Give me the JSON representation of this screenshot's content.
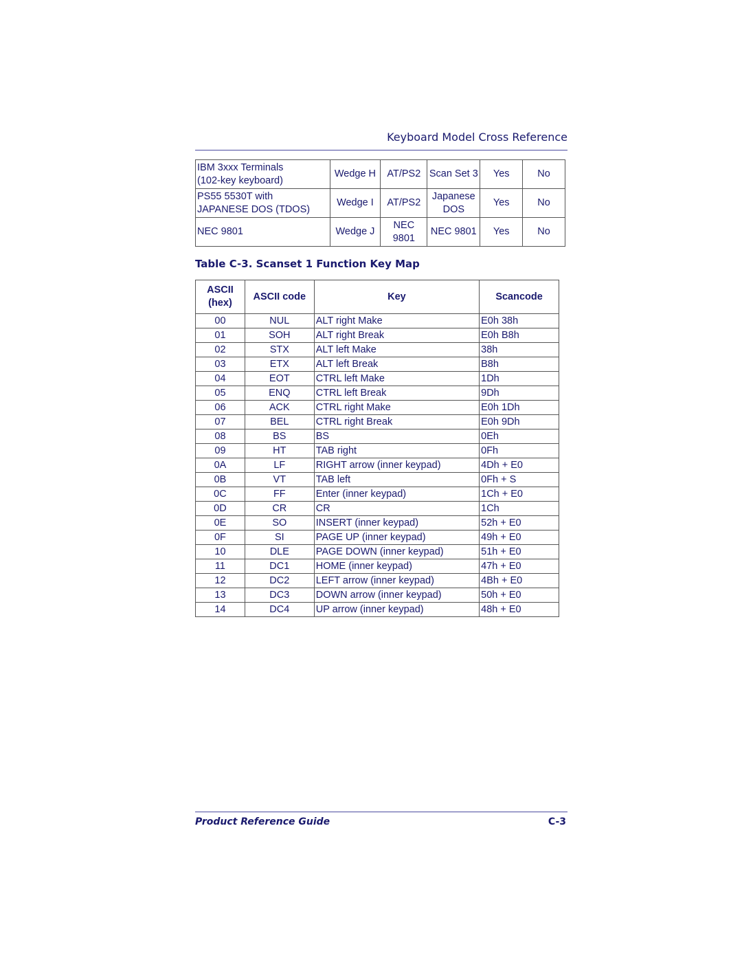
{
  "header": {
    "title": "Keyboard Model Cross Reference"
  },
  "cross_reference_rows": [
    {
      "model": [
        "IBM 3xxx Terminals",
        "(102-key keyboard)"
      ],
      "wedge": "Wedge H",
      "interface": [
        "AT/PS2"
      ],
      "scanset": [
        "Scan Set 3"
      ],
      "col5": "Yes",
      "col6": "No"
    },
    {
      "model": [
        "PS55 5530T with",
        "JAPANESE DOS (TDOS)"
      ],
      "wedge": "Wedge I",
      "interface": [
        "AT/PS2"
      ],
      "scanset": [
        "Japanese",
        "DOS"
      ],
      "col5": "Yes",
      "col6": "No"
    },
    {
      "model": [
        "NEC 9801"
      ],
      "wedge": "Wedge J",
      "interface": [
        "NEC",
        "9801"
      ],
      "scanset": [
        "NEC 9801"
      ],
      "col5": "Yes",
      "col6": "No"
    }
  ],
  "table_c3": {
    "caption": "Table C-3. Scanset 1 Function Key Map",
    "headers": {
      "ascii_hex": [
        "ASCII",
        "(hex)"
      ],
      "ascii_code": "ASCII code",
      "key": "Key",
      "scancode": "Scancode"
    },
    "rows": [
      [
        "00",
        "NUL",
        "ALT right Make",
        "E0h 38h"
      ],
      [
        "01",
        "SOH",
        "ALT right Break",
        "E0h B8h"
      ],
      [
        "02",
        "STX",
        "ALT left Make",
        "38h"
      ],
      [
        "03",
        "ETX",
        "ALT left Break",
        "B8h"
      ],
      [
        "04",
        "EOT",
        "CTRL left Make",
        "1Dh"
      ],
      [
        "05",
        "ENQ",
        "CTRL left Break",
        "9Dh"
      ],
      [
        "06",
        "ACK",
        "CTRL right Make",
        "E0h 1Dh"
      ],
      [
        "07",
        "BEL",
        "CTRL right Break",
        "E0h 9Dh"
      ],
      [
        "08",
        "BS",
        "BS",
        "0Eh"
      ],
      [
        "09",
        "HT",
        "TAB right",
        "0Fh"
      ],
      [
        "0A",
        "LF",
        "RIGHT arrow (inner keypad)",
        "4Dh + E0"
      ],
      [
        "0B",
        "VT",
        "TAB left",
        "0Fh + S"
      ],
      [
        "0C",
        "FF",
        "Enter (inner keypad)",
        "1Ch + E0"
      ],
      [
        "0D",
        "CR",
        "CR",
        "1Ch"
      ],
      [
        "0E",
        "SO",
        "INSERT (inner keypad)",
        "52h + E0"
      ],
      [
        "0F",
        "SI",
        "PAGE UP (inner keypad)",
        "49h + E0"
      ],
      [
        "10",
        "DLE",
        "PAGE DOWN (inner keypad)",
        "51h + E0"
      ],
      [
        "11",
        "DC1",
        "HOME (inner keypad)",
        "47h + E0"
      ],
      [
        "12",
        "DC2",
        "LEFT arrow (inner keypad)",
        "4Bh + E0"
      ],
      [
        "13",
        "DC3",
        "DOWN arrow (inner keypad)",
        "50h + E0"
      ],
      [
        "14",
        "DC4",
        "UP arrow (inner keypad)",
        "48h + E0"
      ]
    ]
  },
  "footer": {
    "left": "Product Reference Guide",
    "right": "C-3"
  }
}
